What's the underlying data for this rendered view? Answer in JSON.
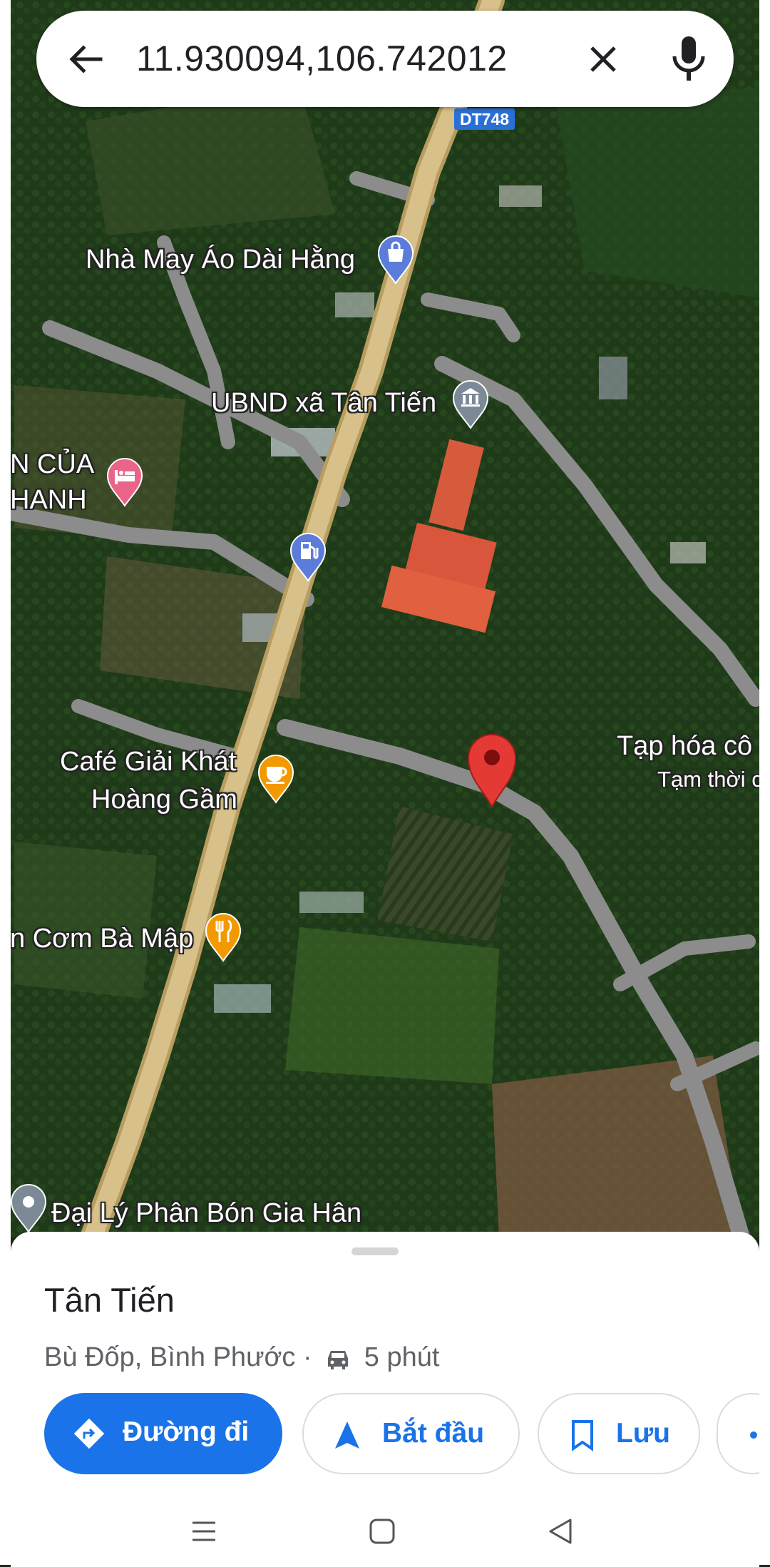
{
  "search": {
    "query": "11.930094,106.742012"
  },
  "map": {
    "route_shield": "DT748",
    "pois": [
      {
        "label": "Nhà May Áo Dài Hằng"
      },
      {
        "label": "UBND xã Tân Tiến"
      },
      {
        "label_line1": "N CỦA",
        "label_line2": "HANH"
      },
      {
        "label": "Café Giải Khát",
        "label_line2": "Hoàng Gầm"
      },
      {
        "label": "n Cơm Bà Mập"
      },
      {
        "label": "Đại Lý Phân Bón Gia Hân"
      },
      {
        "label": "Tạp hóa cô",
        "label_line2": "Tạm thời c"
      }
    ],
    "colors": {
      "highway": "#cdb57a",
      "local_road": "#8c8c8c",
      "pin_red": "#e53935",
      "marker_blue": "#5b7cd9",
      "marker_orange": "#f29900",
      "marker_pink": "#e96488",
      "marker_gray": "#7b8a96"
    }
  },
  "sheet": {
    "title": "Tân Tiến",
    "subtitle": "Bù Đốp, Bình Phước ·",
    "drive_time": "5 phút",
    "buttons": {
      "directions": "Đường đi",
      "start": "Bắt đầu",
      "save": "Lưu"
    }
  }
}
